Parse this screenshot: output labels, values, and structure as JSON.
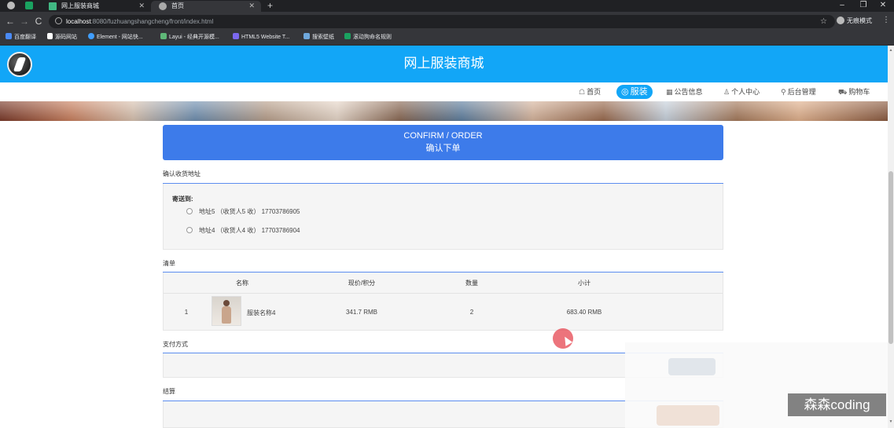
{
  "browser": {
    "tabs": [
      {
        "title": "网上服装商城",
        "active": false
      },
      {
        "title": "首页",
        "active": true
      }
    ],
    "url_host": "localhost",
    "url_rest": ":8080/fuzhuangshangcheng/front/index.html",
    "profile_label": "无痕模式",
    "bookmarks": [
      "百度翻译",
      "源码网站",
      "Element - 网站快...",
      "Layui - 经典开源模...",
      "HTML5 Website T...",
      "搜索壁纸",
      "滚动狗命名规则"
    ],
    "window_controls": {
      "minimize": "–",
      "restore": "❐",
      "close": "✕"
    }
  },
  "site": {
    "title": "网上服装商城",
    "nav": [
      {
        "icon": "☖",
        "label": "首页",
        "active": false
      },
      {
        "icon": "◎",
        "label": "服装",
        "active": true
      },
      {
        "icon": "▦",
        "label": "公告信息",
        "active": false
      },
      {
        "icon": "♙",
        "label": "个人中心",
        "active": false
      },
      {
        "icon": "⚲",
        "label": "后台管理",
        "active": false
      },
      {
        "icon": "⛟",
        "label": "购物车",
        "active": false
      }
    ]
  },
  "order": {
    "header_en": "CONFIRM / ORDER",
    "header_zh": "确认下单",
    "address_section": {
      "title": "确认收货地址",
      "ship_to_label": "寄送到:",
      "addresses": [
        "地址5 （收货人5 收） 17703786905",
        "地址4 （收货人4 收） 17703786904"
      ]
    },
    "list_section": {
      "title": "清单",
      "columns": [
        "名称",
        "现价/积分",
        "数量",
        "小计"
      ],
      "rows": [
        {
          "index": "1",
          "name": "服装名称4",
          "price": "341.7 RMB",
          "qty": "2",
          "subtotal": "683.40 RMB"
        }
      ]
    },
    "payment_section": {
      "title": "支付方式"
    },
    "checkout_section": {
      "title": "结算"
    }
  },
  "watermark": "森森coding",
  "colors": {
    "header_blue": "#12a6f7",
    "confirm_blue": "#3d7bea",
    "section_line": "#5b8def"
  }
}
